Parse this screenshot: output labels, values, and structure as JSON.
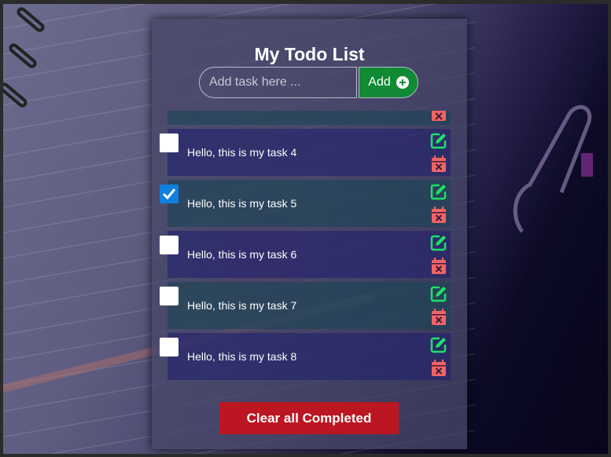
{
  "app": {
    "title": "My Todo List"
  },
  "form": {
    "input_placeholder": "Add task here ...",
    "input_value": "",
    "add_label": "Add"
  },
  "tasks": [
    {
      "text": "Hello, this is my task 4",
      "completed": false
    },
    {
      "text": "Hello, this is my task 5",
      "completed": true
    },
    {
      "text": "Hello, this is my task 6",
      "completed": false
    },
    {
      "text": "Hello, this is my task 7",
      "completed": false
    },
    {
      "text": "Hello, this is my task 8",
      "completed": false
    }
  ],
  "actions": {
    "clear_completed_label": "Clear all Completed"
  },
  "icons": {
    "add": "plus-circle-icon",
    "edit": "edit-pencil-icon",
    "delete": "calendar-x-icon",
    "check": "checkmark-icon"
  },
  "colors": {
    "add_button": "#108a35",
    "edit_icon": "#1ee06a",
    "delete_icon": "#f26464",
    "clear_button": "#bb1622",
    "checkbox_checked": "#0f7fe0"
  }
}
